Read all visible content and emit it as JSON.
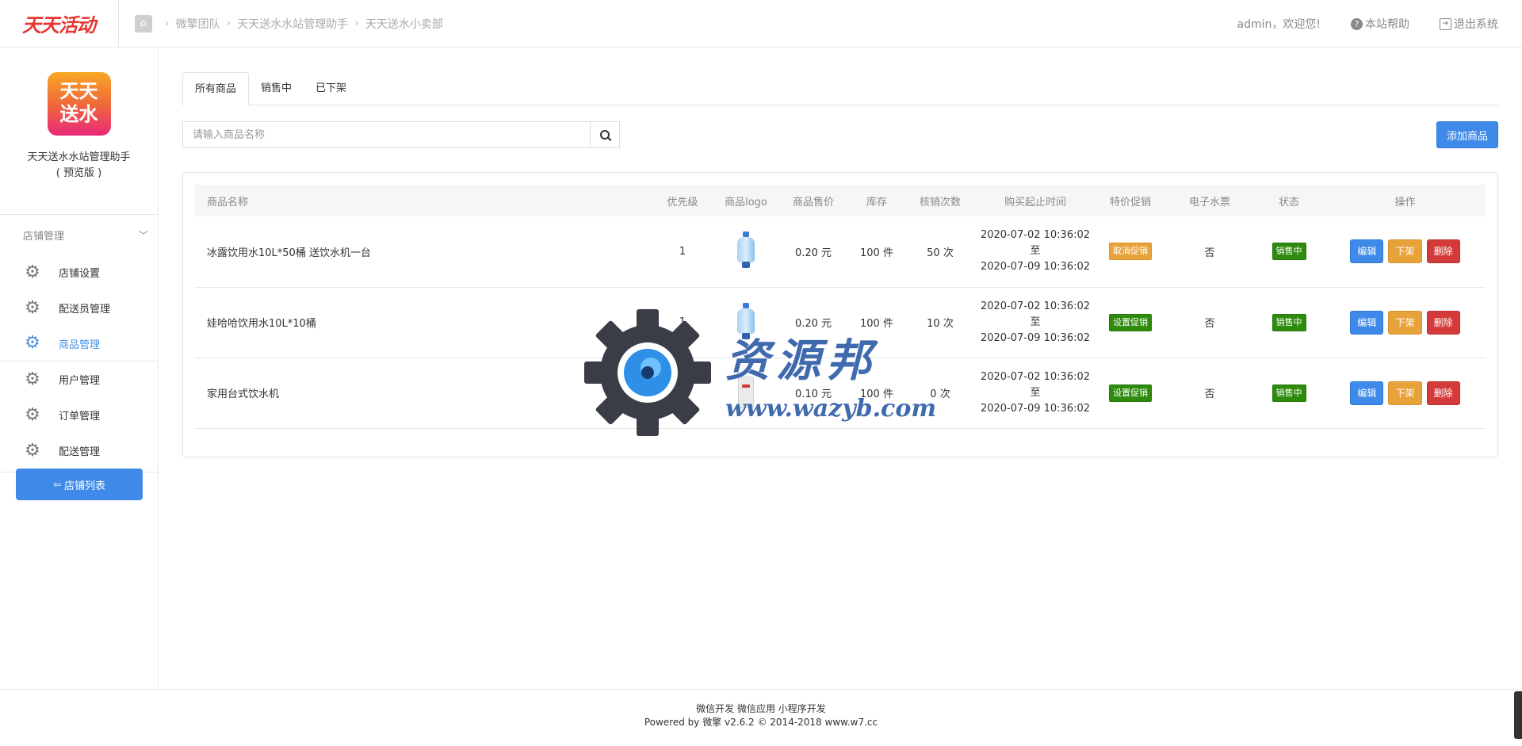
{
  "header": {
    "logo": "天天活动",
    "breadcrumb": [
      "微擎团队",
      "天天送水水站管理助手",
      "天天送水小卖部"
    ],
    "user_greeting": "admin，欢迎您!",
    "help_label": "本站帮助",
    "logout_label": "退出系统"
  },
  "sidebar": {
    "app_logo_line1": "天天",
    "app_logo_line2": "送水",
    "app_name_line1": "天天送水水站管理助手",
    "app_name_line2": "( 预览版 )",
    "section_title": "店铺管理",
    "items": [
      {
        "label": "店铺设置",
        "active": false
      },
      {
        "label": "配送员管理",
        "active": false
      },
      {
        "label": "商品管理",
        "active": true
      },
      {
        "label": "用户管理",
        "active": false
      },
      {
        "label": "订单管理",
        "active": false
      },
      {
        "label": "配送管理",
        "active": false
      }
    ],
    "store_list_label": "店铺列表"
  },
  "main": {
    "tabs": [
      {
        "label": "所有商品",
        "active": true
      },
      {
        "label": "销售中",
        "active": false
      },
      {
        "label": "已下架",
        "active": false
      }
    ],
    "search": {
      "placeholder": "请输入商品名称",
      "value": ""
    },
    "add_button": "添加商品",
    "table": {
      "columns": [
        "商品名称",
        "优先级",
        "商品logo",
        "商品售价",
        "库存",
        "核销次数",
        "购买起止时间",
        "特价促销",
        "电子水票",
        "状态",
        "操作"
      ],
      "rows": [
        {
          "name": "冰露饮用水10L*50桶 送饮水机一台",
          "priority": "1",
          "logo": "water-bottle",
          "price": "0.20 元",
          "stock": "100 件",
          "verify_count": "50 次",
          "start": "2020-07-02 10:36:02",
          "to": "至",
          "end": "2020-07-09 10:36:02",
          "promo": "取消促销",
          "promo_color": "#e8a23a",
          "eticket": "否",
          "status": "销售中"
        },
        {
          "name": "娃哈哈饮用水10L*10桶",
          "priority": "1",
          "logo": "water-bottle",
          "price": "0.20 元",
          "stock": "100 件",
          "verify_count": "10 次",
          "start": "2020-07-02 10:36:02",
          "to": "至",
          "end": "2020-07-09 10:36:02",
          "promo": "设置促销",
          "promo_color": "#2e8b0d",
          "eticket": "否",
          "status": "销售中"
        },
        {
          "name": "家用台式饮水机",
          "priority": "1",
          "logo": "water-dispenser",
          "price": "0.10 元",
          "stock": "100 件",
          "verify_count": "0 次",
          "start": "2020-07-02 10:36:02",
          "to": "至",
          "end": "2020-07-09 10:36:02",
          "promo": "设置促销",
          "promo_color": "#2e8b0d",
          "eticket": "否",
          "status": "销售中"
        }
      ],
      "actions": {
        "edit": "编辑",
        "offshelf": "下架",
        "delete": "删除"
      }
    }
  },
  "watermark": {
    "text": "资源邦",
    "url": "www.wazyb.com"
  },
  "footer": {
    "line1": "微信开发 微信应用 小程序开发",
    "line2": "Powered by 微擎 v2.6.2 © 2014-2018 www.w7.cc"
  }
}
